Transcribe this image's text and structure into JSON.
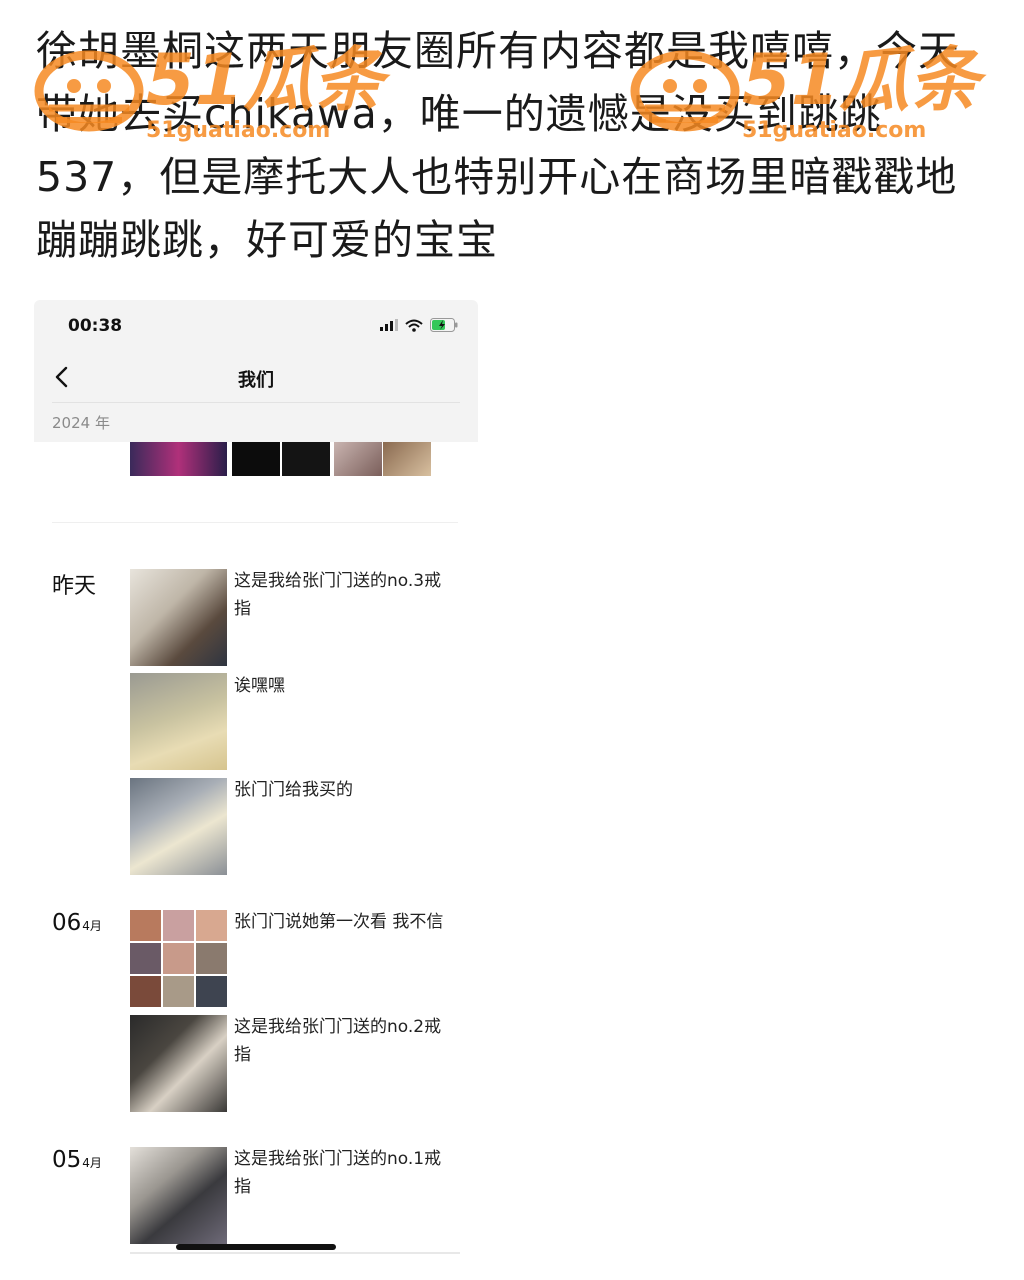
{
  "caption": "徐胡墨桐这两天朋友圈所有内容都是我嘻嘻，今天带她去买chikawa，唯一的遗憾是没买到跳跳537，但是摩托大人也特别开心在商场里暗戳戳地蹦蹦跳跳，好可爱的宝宝",
  "watermark": {
    "brand": "51瓜条",
    "url": "51guatiao.com",
    "color": "#F68A22"
  },
  "phone": {
    "status_time": "00:38",
    "status_icons": [
      "signal-icon",
      "wifi-icon",
      "battery-charging-icon"
    ],
    "battery_color": "#34C759",
    "nav_title": "我们",
    "year": "2024 年",
    "sections": [
      {
        "date_label": "昨天",
        "entries": [
          {
            "text": "这是我给张门门送的no.3戒指"
          },
          {
            "text": "诶嘿嘿"
          },
          {
            "text": "张门门给我买的"
          }
        ]
      },
      {
        "date_day": "06",
        "date_month": "4月",
        "entries": [
          {
            "text": "张门门说她第一次看 我不信"
          },
          {
            "text": "这是我给张门门送的no.2戒指"
          }
        ]
      },
      {
        "date_day": "05",
        "date_month": "4月",
        "entries": [
          {
            "text": "这是我给张门门送的no.1戒指"
          }
        ]
      }
    ]
  }
}
